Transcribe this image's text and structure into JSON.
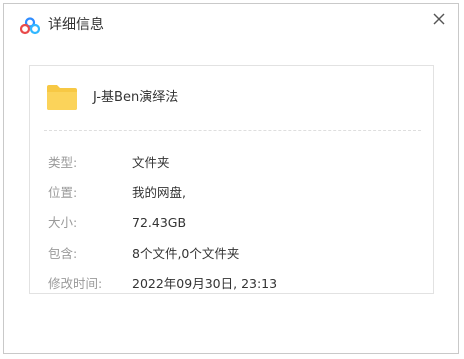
{
  "dialog": {
    "title": "详细信息",
    "icon": "baidu-netdisk-logo-icon",
    "close_icon": "close-icon"
  },
  "file": {
    "icon": "folder-icon",
    "icon_color": "#F7C844",
    "name": "J-基Ben演绎法"
  },
  "details": [
    {
      "label": "类型:",
      "value": "文件夹"
    },
    {
      "label": "位置:",
      "value": "我的网盘,"
    },
    {
      "label": "大小:",
      "value": "72.43GB"
    },
    {
      "label": "包含:",
      "value": "8个文件,0个文件夹"
    },
    {
      "label": "修改时间:",
      "value": "2022年09月30日, 23:13"
    }
  ]
}
